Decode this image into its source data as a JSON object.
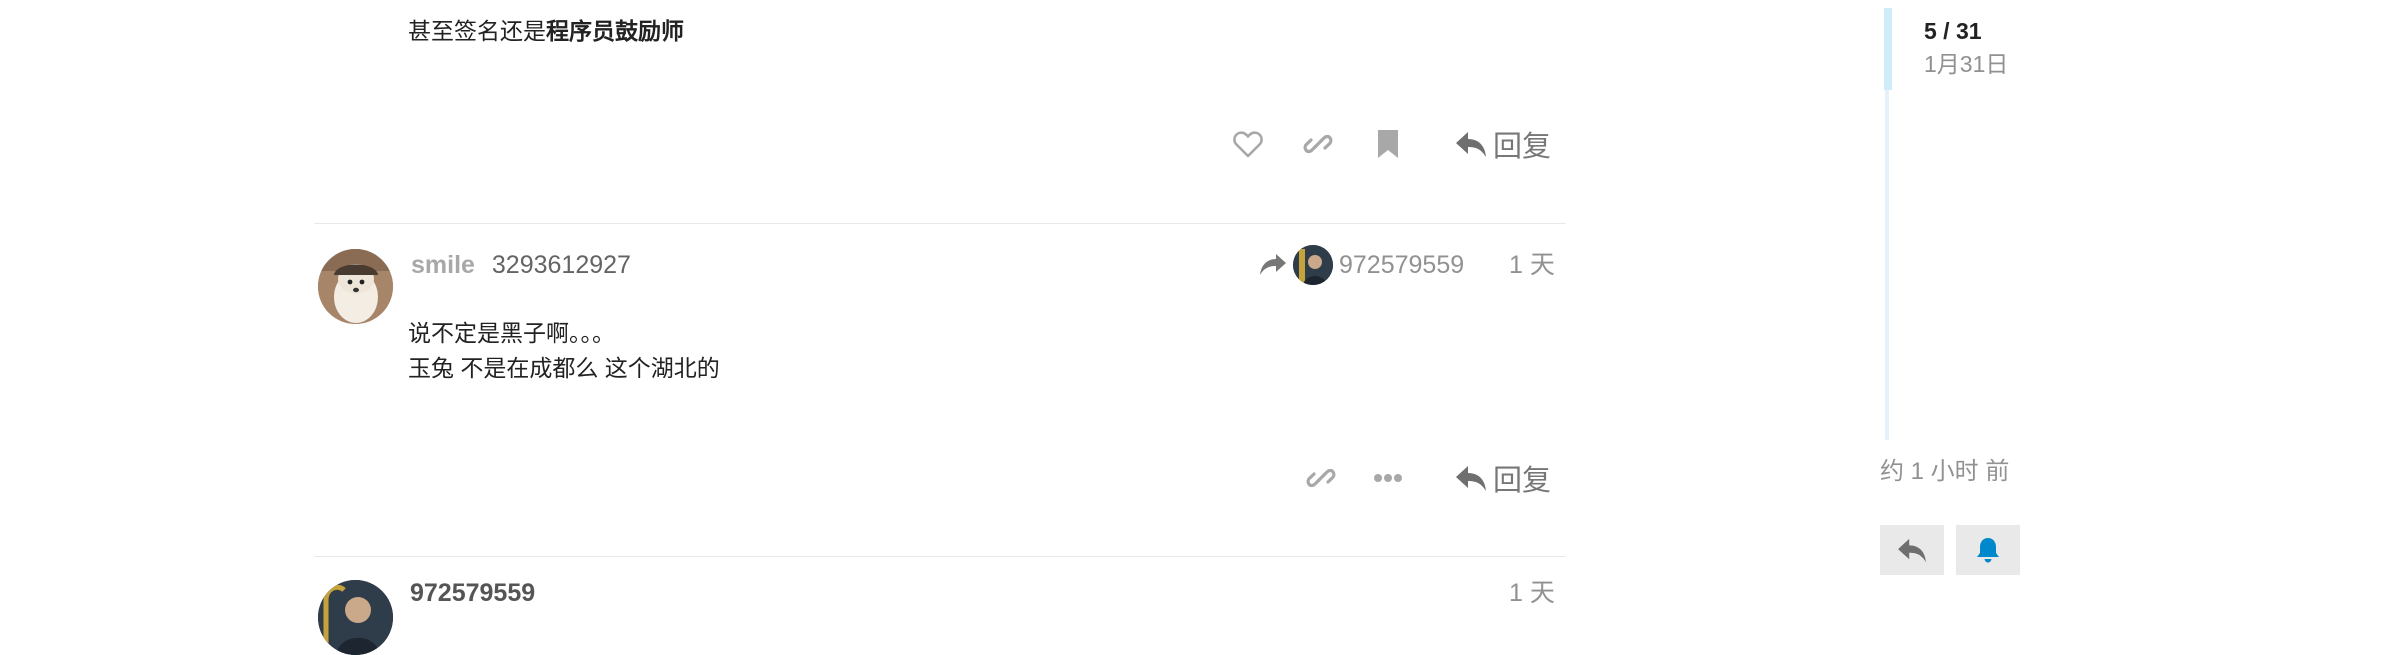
{
  "post_prev": {
    "text_prefix": "甚至签名还是",
    "text_bold": "程序员鼓励师",
    "reply_label": "回复"
  },
  "post_main": {
    "username": "smile",
    "user_id": "3293612927",
    "reply_to_user": "972579559",
    "age": "1 天",
    "line1": "说不定是黑子啊。。。",
    "line2": "玉兔 不是在成都么 这个湖北的",
    "reply_label": "回复"
  },
  "post_next": {
    "username": "972579559",
    "age": "1 天"
  },
  "timeline": {
    "position": "5 / 31",
    "date": "1月31日",
    "last_activity": "约 1 小时 前"
  },
  "colors": {
    "accent": "#0088cc",
    "icon_grey": "#9a9a9a",
    "meta_grey": "#919191"
  }
}
